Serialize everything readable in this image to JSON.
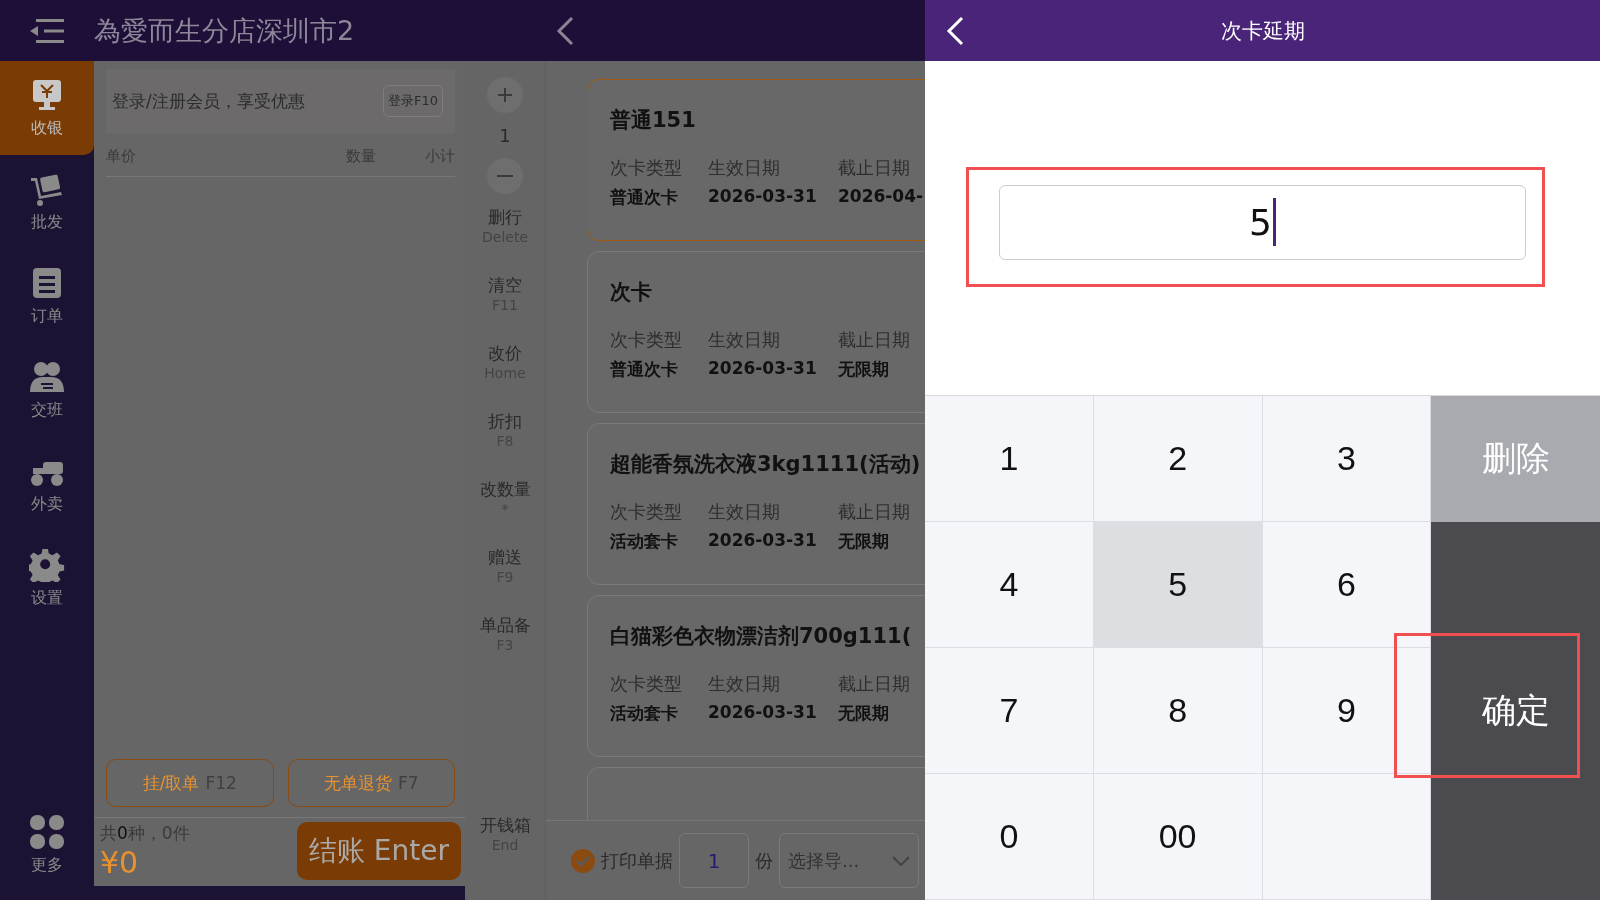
{
  "top_bar": {
    "store_name": "為愛而生分店深圳市2"
  },
  "sidebar": {
    "items": [
      {
        "label": "收银",
        "selected": true
      },
      {
        "label": "批发",
        "selected": false
      },
      {
        "label": "订单",
        "selected": false
      },
      {
        "label": "交班",
        "selected": false
      },
      {
        "label": "外卖",
        "selected": false
      },
      {
        "label": "设置",
        "selected": false
      }
    ],
    "more": "更多"
  },
  "cart": {
    "member_prompt": "登录/注册会员，享受优惠",
    "login_button": "登录F10",
    "columns": [
      "单价",
      "数量",
      "小计"
    ],
    "buttons": [
      {
        "label": "挂/取单",
        "key": "F12"
      },
      {
        "label": "无单退货",
        "key": "F7"
      }
    ],
    "summary": "共**0**种，0件",
    "total": "¥0",
    "checkout": "结账 Enter"
  },
  "actions": {
    "quantity": "1",
    "items": [
      {
        "label": "删行",
        "key": "Delete"
      },
      {
        "label": "清空",
        "key": "F11"
      },
      {
        "label": "改价",
        "key": "Home"
      },
      {
        "label": "折扣",
        "key": "F8"
      },
      {
        "label": "改数量",
        "key": "*"
      },
      {
        "label": "赠送",
        "key": "F9"
      },
      {
        "label": "单品备",
        "key": "F3"
      }
    ],
    "drawer": {
      "label": "开钱箱",
      "key": "End"
    }
  },
  "cards": [
    {
      "title": "普通151",
      "selected": true,
      "fields": [
        {
          "label": "次卡类型",
          "value": "普通次卡"
        },
        {
          "label": "生效日期",
          "value": "2026-03-31"
        },
        {
          "label": "截止日期",
          "value": "2026-04-"
        }
      ]
    },
    {
      "title": "次卡",
      "selected": false,
      "fields": [
        {
          "label": "次卡类型",
          "value": "普通次卡"
        },
        {
          "label": "生效日期",
          "value": "2026-03-31"
        },
        {
          "label": "截止日期",
          "value": "无限期"
        }
      ]
    },
    {
      "title": "超能香氛洗衣液3kg1111(活动)",
      "selected": false,
      "fields": [
        {
          "label": "次卡类型",
          "value": "活动套卡"
        },
        {
          "label": "生效日期",
          "value": "2026-03-31"
        },
        {
          "label": "截止日期",
          "value": "无限期"
        }
      ]
    },
    {
      "title": "白猫彩色衣物漂洁剂700g111(",
      "selected": false,
      "fields": [
        {
          "label": "次卡类型",
          "value": "活动套卡"
        },
        {
          "label": "生效日期",
          "value": "2026-03-31"
        },
        {
          "label": "截止日期",
          "value": "无限期"
        }
      ]
    },
    {
      "selected": false
    }
  ],
  "print_bar": {
    "checked": true,
    "label": "打印单据",
    "copies": "1",
    "unit": "份",
    "guide_select": "选择导..."
  },
  "dialog": {
    "title": "次卡延期",
    "value": "5",
    "highlighted": true,
    "keys": [
      {
        "label": "1",
        "kind": "digit",
        "pressed": false
      },
      {
        "label": "2",
        "kind": "digit",
        "pressed": false
      },
      {
        "label": "3",
        "kind": "digit",
        "pressed": false
      },
      {
        "label": "删除",
        "kind": "delete"
      },
      {
        "label": "4",
        "kind": "digit",
        "pressed": false
      },
      {
        "label": "5",
        "kind": "digit",
        "pressed": true
      },
      {
        "label": "6",
        "kind": "digit",
        "pressed": false
      },
      {
        "label": "7",
        "kind": "digit",
        "pressed": false
      },
      {
        "label": "8",
        "kind": "digit",
        "pressed": false
      },
      {
        "label": "9",
        "kind": "digit",
        "pressed": false
      },
      {
        "label": "确定",
        "kind": "confirm",
        "highlighted": true
      },
      {
        "label": "0",
        "kind": "digit",
        "pressed": false
      },
      {
        "label": "00",
        "kind": "digit",
        "pressed": false
      },
      {
        "kind": "blank"
      }
    ]
  }
}
